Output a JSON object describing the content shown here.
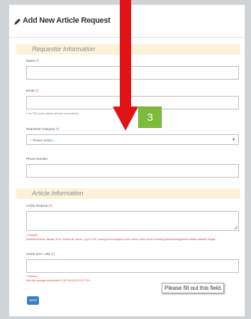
{
  "form": {
    "title": "Add New Article Request",
    "submit_label": "Send"
  },
  "requestor_section": {
    "heading": "Requestor Information",
    "name_label": "Name",
    "email_label": "Email",
    "email_note": "** for CEU users, please use your work address",
    "category_label": "Requestor Category",
    "category_selected": "-- Please Select --",
    "phone_label": "Phone Number",
    "required_mark": "(*)"
  },
  "article_section": {
    "heading": "Article Information",
    "request_label": "Article Request",
    "request_example_title": "* Example",
    "request_example_text": "Examiners/Hours January 2012; Volume 66, Issue 1, pp 57-113: Looking for the impact of peer review; loose count of funding policies/arrangements related research impact",
    "doi_label": "Article DOI / URL",
    "doi_example_title": "* Example",
    "doi_example_text": "http://link.springer.com/article/10.1007/s11192-012-0778-5"
  },
  "validation": {
    "tooltip": "Please fill out this field."
  },
  "overlay": {
    "step_number": "3"
  },
  "colors": {
    "band": "#fbf3d9",
    "required": "#d9363e",
    "submit": "#3a7fc1",
    "step_badge": "#7dbb3b",
    "arrow": "#e01414"
  },
  "icons": {
    "title_icon": "pencil-icon",
    "select_icon": "caret-down-icon",
    "resize_icon": "resize-grip-icon"
  }
}
